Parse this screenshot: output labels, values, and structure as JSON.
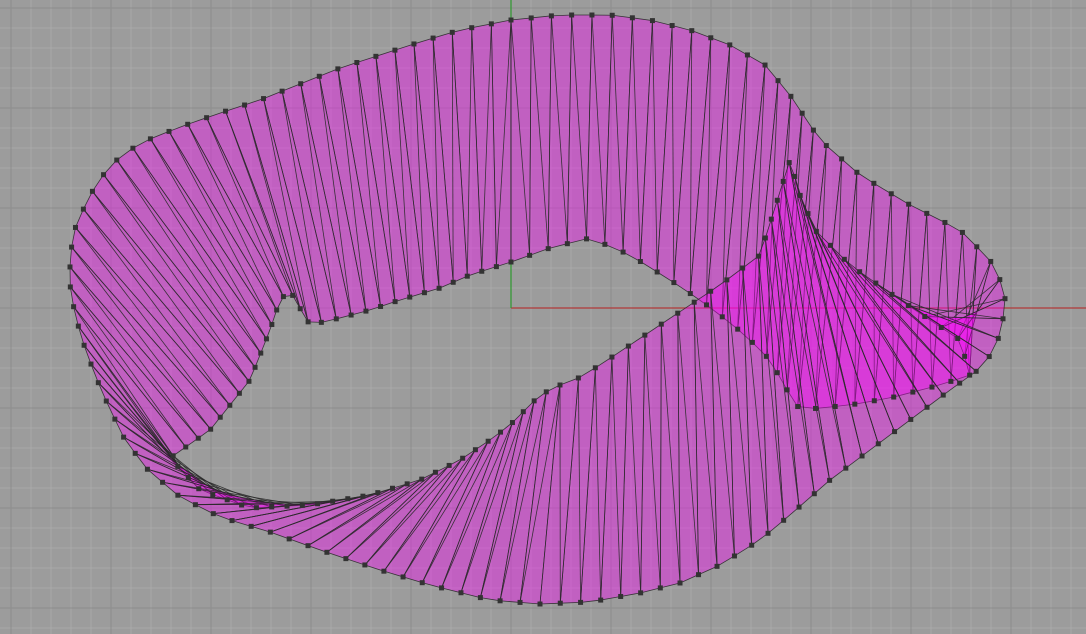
{
  "viewport": {
    "view": "top",
    "background_color": "#9c9c9c",
    "grid": {
      "visible": true,
      "minor_color": "#a9a9a9",
      "major_color": "#8d8d8d"
    },
    "axes": {
      "x_axis_color": "#b13a3a",
      "y_axis_color": "#2f9a2f"
    },
    "surface": {
      "fill_color": "#ff00ff",
      "edge_color": "#2a2a2a",
      "control_point_color": "#333333",
      "strip_count": 120
    }
  }
}
